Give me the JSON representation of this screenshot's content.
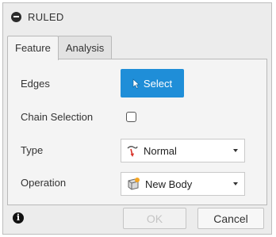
{
  "dialog": {
    "title": "RULED",
    "collapse_icon": "minus-circle-icon"
  },
  "tabs": [
    {
      "label": "Feature",
      "active": true
    },
    {
      "label": "Analysis",
      "active": false
    }
  ],
  "fields": {
    "edges": {
      "label": "Edges",
      "button_label": "Select",
      "icon": "cursor-arrow-icon"
    },
    "chain_selection": {
      "label": "Chain Selection",
      "checked": false
    },
    "type": {
      "label": "Type",
      "value": "Normal",
      "icon": "ruled-normal-icon"
    },
    "operation": {
      "label": "Operation",
      "value": "New Body",
      "icon": "new-body-icon"
    }
  },
  "footer": {
    "info_icon": "info-icon",
    "ok_label": "OK",
    "ok_enabled": false,
    "cancel_label": "Cancel"
  },
  "colors": {
    "accent": "#1f8ed8",
    "dialog_bg": "#ececec",
    "panel_bg": "#f4f4f4",
    "disabled_text": "#c4c4c4"
  }
}
